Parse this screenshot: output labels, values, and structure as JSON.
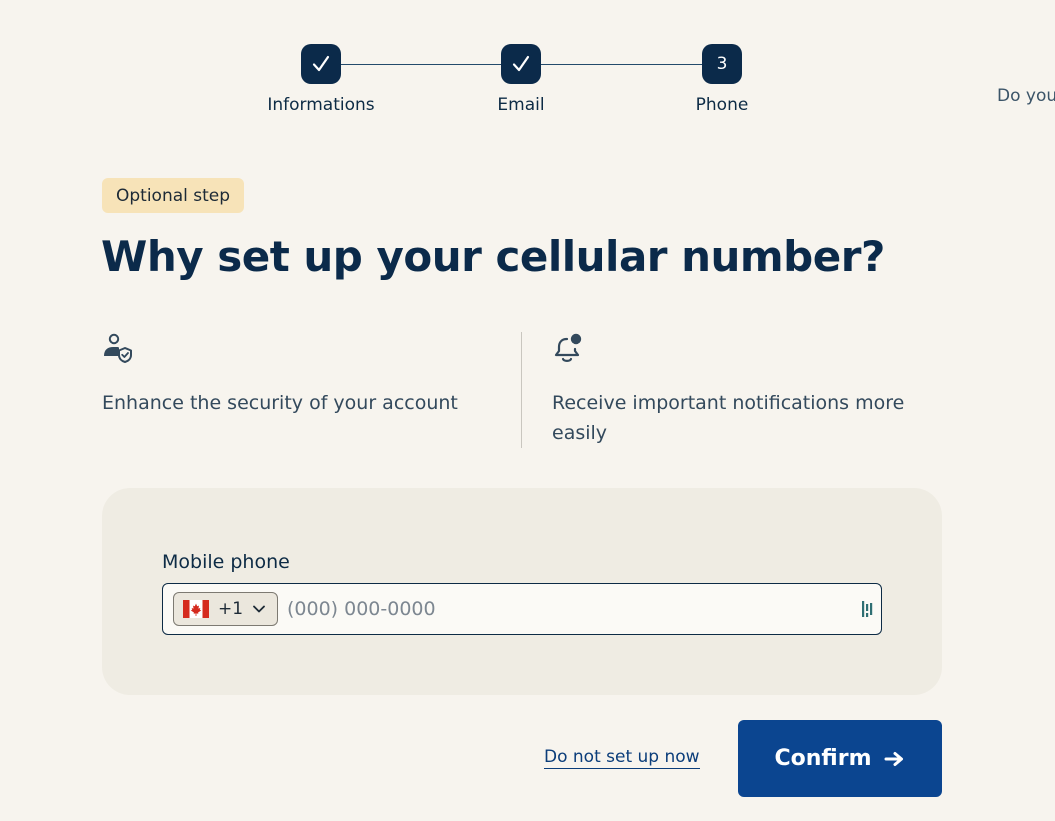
{
  "stepper": {
    "steps": [
      {
        "label": "Informations",
        "state": "completed",
        "icon": "check-icon"
      },
      {
        "label": "Email",
        "state": "completed",
        "icon": "check-icon"
      },
      {
        "label": "Phone",
        "state": "current",
        "number": "3"
      }
    ]
  },
  "side_question": "Do you",
  "badge": "Optional step",
  "title": "Why set up your cellular number?",
  "features": [
    {
      "icon": "user-shield-icon",
      "text": "Enhance the security of your account"
    },
    {
      "icon": "bell-notification-icon",
      "text": "Receive important notifications more easily"
    }
  ],
  "form": {
    "label": "Mobile phone",
    "country": {
      "flag": "canada-flag-icon",
      "dial_code": "+1"
    },
    "placeholder": "(000) 000-0000",
    "value": ""
  },
  "actions": {
    "skip_label": "Do not set up now",
    "confirm_label": "Confirm"
  },
  "colors": {
    "background": "#f7f4ee",
    "primary": "#0b4590",
    "navy": "#0b2a4a",
    "badge_bg": "#f7e3b8",
    "card_bg": "#efece3"
  }
}
